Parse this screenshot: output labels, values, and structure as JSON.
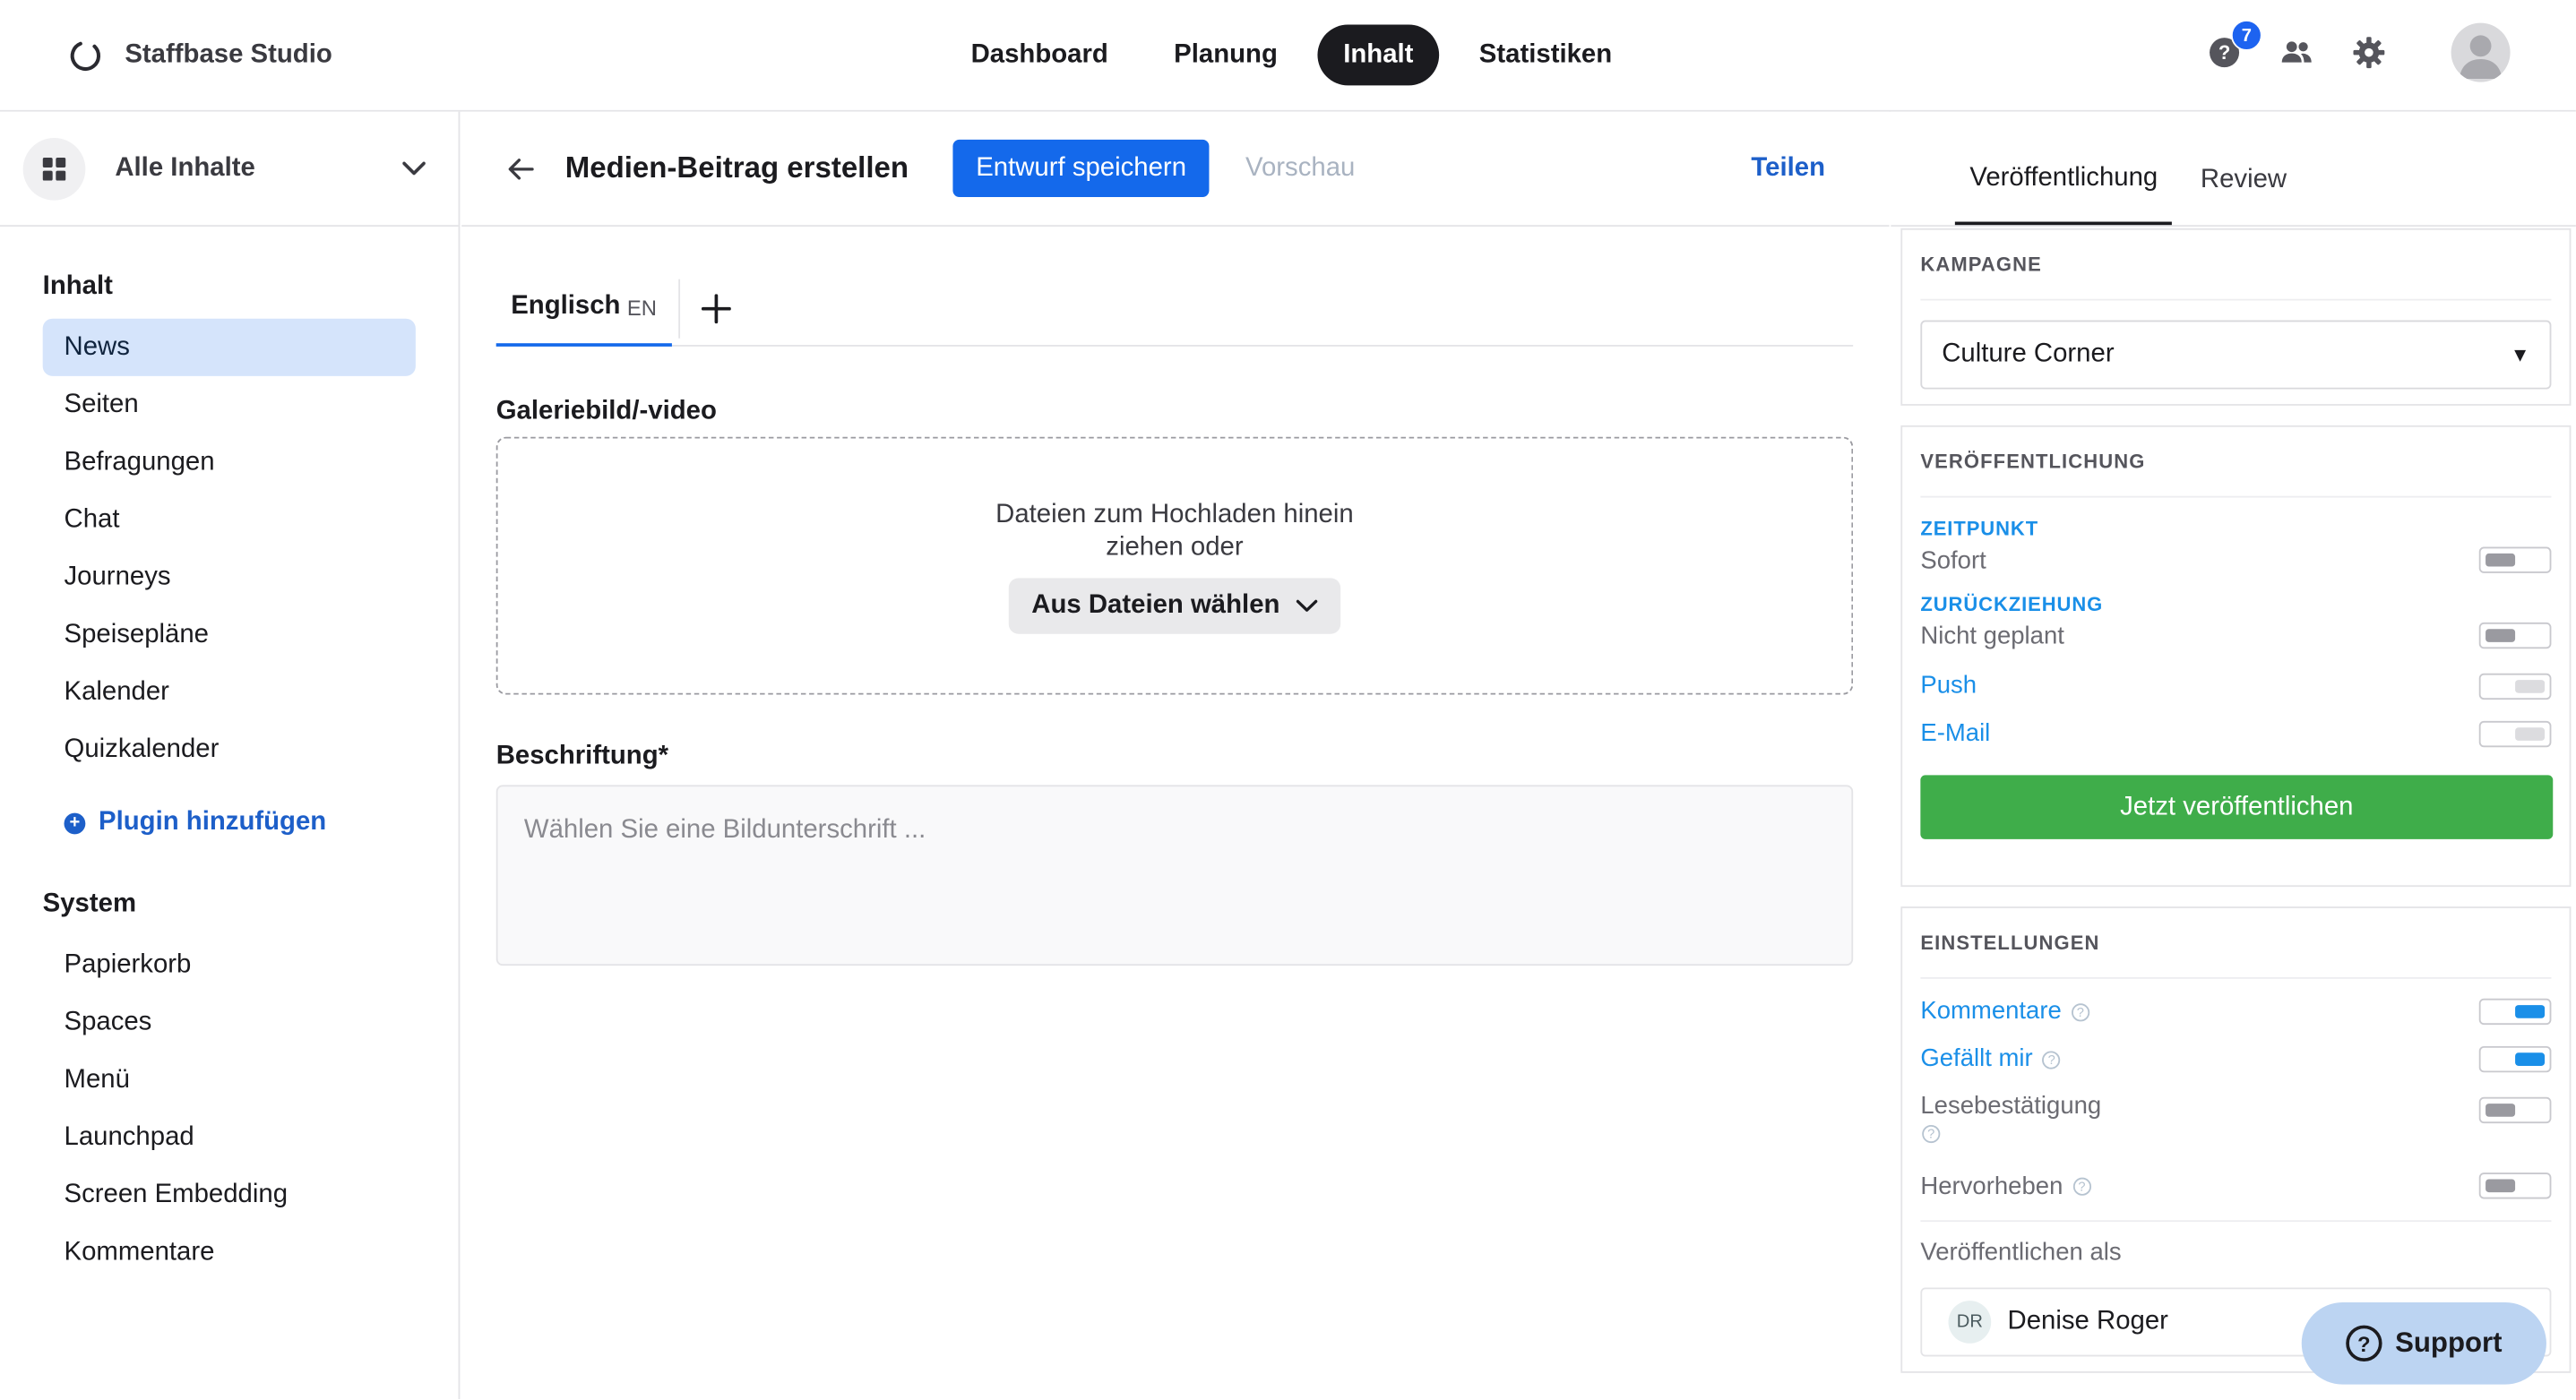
{
  "app": {
    "brand_name": "Staffbase Studio",
    "nav_tabs": [
      {
        "label": "Dashboard",
        "active": false
      },
      {
        "label": "Planung",
        "active": false
      },
      {
        "label": "Inhalt",
        "active": true
      },
      {
        "label": "Statistiken",
        "active": false
      }
    ],
    "help_badge_count": "7",
    "help_icon_glyph": "?",
    "icons": [
      "help-icon",
      "people-icon",
      "gear-icon",
      "avatar"
    ]
  },
  "sidebar": {
    "content_switch_label": "Alle Inhalte",
    "content_section_title": "Inhalt",
    "content_items": [
      {
        "label": "News",
        "active": true
      },
      {
        "label": "Seiten",
        "active": false
      },
      {
        "label": "Befragungen",
        "active": false
      },
      {
        "label": "Chat",
        "active": false
      },
      {
        "label": "Journeys",
        "active": false
      },
      {
        "label": "Speisepläne",
        "active": false
      },
      {
        "label": "Kalender",
        "active": false
      },
      {
        "label": "Quizkalender",
        "active": false
      }
    ],
    "plugin_add_label": "Plugin hinzufügen",
    "system_section_title": "System",
    "system_items": [
      {
        "label": "Papierkorb"
      },
      {
        "label": "Spaces"
      },
      {
        "label": "Menü"
      },
      {
        "label": "Launchpad"
      },
      {
        "label": "Screen Embedding"
      },
      {
        "label": "Kommentare"
      }
    ]
  },
  "editor": {
    "title": "Medien-Beitrag erstellen",
    "save_label": "Entwurf speichern",
    "preview_label": "Vorschau",
    "share_label": "Teilen",
    "language_tab": {
      "label": "Englisch",
      "code": "EN"
    },
    "add_language_glyph": "+",
    "gallery_label": "Galeriebild/-video",
    "dropzone_text": "Dateien zum Hochladen hinein ziehen oder",
    "file_button_label": "Aus Dateien wählen",
    "caption_label": "Beschriftung*",
    "caption_placeholder": "Wählen Sie eine Bildunterschrift ...",
    "caption_value": ""
  },
  "panel": {
    "tabs": [
      {
        "label": "Veröffentlichung",
        "active": true
      },
      {
        "label": "Review",
        "active": false
      }
    ],
    "campaign": {
      "title": "KAMPAGNE",
      "selected": "Culture Corner",
      "caret_glyph": "▼"
    },
    "publication": {
      "title": "VERÖFFENTLICHUNG",
      "timing_title": "ZEITPUNKT",
      "timing_value": "Sofort",
      "withdrawal_title": "ZURÜCKZIEHUNG",
      "withdrawal_value": "Nicht geplant",
      "push_label": "Push",
      "email_label": "E-Mail",
      "publish_button_label": "Jetzt veröffentlichen"
    },
    "settings": {
      "title": "EINSTELLUNGEN",
      "info_glyph": "?",
      "comments_label": "Kommentare",
      "comments_on": true,
      "likes_label": "Gefällt mir",
      "likes_on": true,
      "read_receipt_label": "Lesebestätigung",
      "read_receipt_on": false,
      "highlight_label": "Hervorheben",
      "highlight_on": false,
      "publish_as_label": "Veröffentlichen als",
      "author_initials": "DR",
      "author_name": "Denise Roger"
    }
  },
  "support": {
    "label": "Support",
    "icon_glyph": "?"
  },
  "colors": {
    "accent": "#1469eb",
    "link": "#1d5fc9",
    "toggle_on": "#1a8fe8",
    "publish_green": "#3fad4a",
    "support_bg": "#bcd4f2"
  }
}
